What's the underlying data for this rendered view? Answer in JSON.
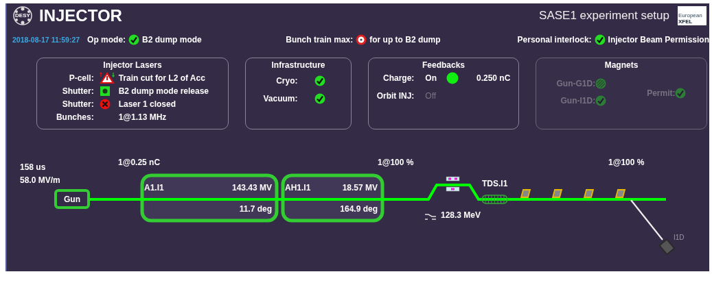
{
  "header": {
    "logo_text": "DESY",
    "title": "INJECTOR",
    "setup": "SASE1 experiment setup",
    "xfel_logo": {
      "small": "European",
      "large": "XFEL"
    }
  },
  "status": {
    "timestamp": "2018-08-17 11:59:27",
    "items": [
      {
        "label": "Op mode:",
        "kind": "check",
        "value": "B2 dump mode"
      },
      {
        "label": "Bunch train max:",
        "kind": "limit",
        "value": "for up to B2 dump"
      },
      {
        "label": "Personal interlock:",
        "kind": "check",
        "value": "Injector Beam Permission"
      }
    ]
  },
  "panels": [
    {
      "title": "Injector Lasers",
      "disabled": false,
      "columns": [
        [
          {
            "label": "P-cell:",
            "kind": "warning",
            "text": "Train cut for L2 of Acc"
          },
          {
            "label": "Shutter:",
            "kind": "square",
            "text": "B2 dump mode release"
          },
          {
            "label": "Shutter:",
            "kind": "cross",
            "text": "Laser 1 closed"
          },
          {
            "label": "Bunches:",
            "text": "1@1.13 MHz"
          }
        ]
      ]
    },
    {
      "title": "Infrastructure",
      "disabled": false,
      "columns": [
        [
          {
            "label": "Cryo:",
            "kind": "check"
          },
          {
            "label": "Vacuum:",
            "kind": "check"
          }
        ]
      ]
    },
    {
      "title": "Feedbacks",
      "disabled": false,
      "columns": [
        [
          {
            "label": "Charge:",
            "state": "On",
            "active": true,
            "kind": "dot",
            "text": "0.250 nC"
          },
          {
            "label": "Orbit INJ:",
            "state": "Off",
            "active": false
          }
        ]
      ]
    },
    {
      "title": "Magnets",
      "disabled": true,
      "columns": [
        [
          {
            "label": "Gun-G1D:",
            "kind": "hatched"
          },
          {
            "label": "Gun-I1D:",
            "kind": "check"
          }
        ],
        [
          {
            "label": "Permit:",
            "kind": "check"
          }
        ]
      ]
    }
  ],
  "diagram": {
    "gun_info": [
      "158 us",
      "58.0 MV/m"
    ],
    "charge": "1@0.25 nC",
    "gun": "Gun",
    "cavities": [
      {
        "name": "A1.I1",
        "voltage": "143.43 MV",
        "phase": "11.7 deg"
      },
      {
        "name": "AH1.I1",
        "voltage": "18.57 MV",
        "phase": "164.9 deg"
      }
    ],
    "transmission": [
      "1@100 %",
      "1@100 %"
    ],
    "energy": "128.3 MeV",
    "tds": "TDS.I1",
    "dump": "I1D"
  }
}
